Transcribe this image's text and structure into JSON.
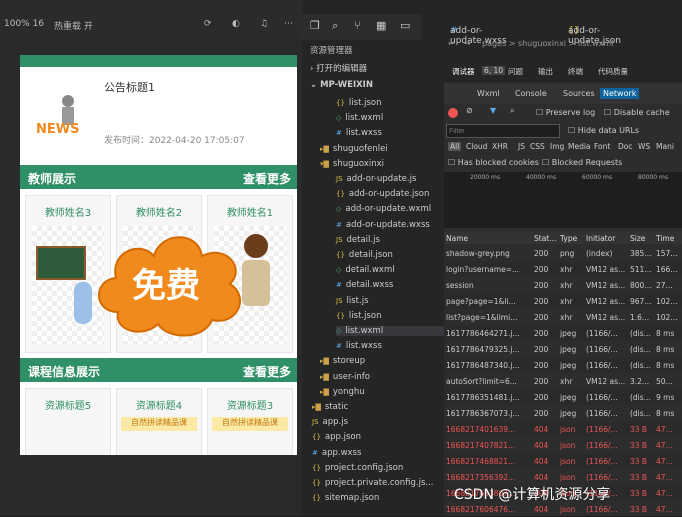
{
  "simulator": {
    "zoom": "100% 16",
    "mode": "热重载 开",
    "notice_title": "公告标题1",
    "notice_date": "发布时间：2022-04-20 17:05:07",
    "news_badge": "NEWS",
    "teacher_section": "教师展示",
    "more": "查看更多",
    "teachers": [
      "教师姓名3",
      "教师姓名2",
      "教师姓名1"
    ],
    "course_section": "课程信息展示",
    "resources": [
      "资源标题5",
      "资源标题4",
      "资源标题3"
    ],
    "banner_text": "自然拼读精品课",
    "free_badge": "免费"
  },
  "explorer": {
    "title": "资源管理器",
    "open_editors": "打开的编辑器",
    "project": "MP-WEIXIN",
    "items": [
      {
        "label": "list.json",
        "type": "json"
      },
      {
        "label": "list.wxml",
        "type": "wxml"
      },
      {
        "label": "list.wxss",
        "type": "wxss"
      },
      {
        "label": "shuguofenlei",
        "type": "folder"
      },
      {
        "label": "shuguoxinxi",
        "type": "folder-open"
      },
      {
        "label": "add-or-update.js",
        "type": "js"
      },
      {
        "label": "add-or-update.json",
        "type": "json"
      },
      {
        "label": "add-or-update.wxml",
        "type": "wxml"
      },
      {
        "label": "add-or-update.wxss",
        "type": "wxss"
      },
      {
        "label": "detail.js",
        "type": "js"
      },
      {
        "label": "detail.json",
        "type": "json"
      },
      {
        "label": "detail.wxml",
        "type": "wxml"
      },
      {
        "label": "detail.wxss",
        "type": "wxss"
      },
      {
        "label": "list.js",
        "type": "js"
      },
      {
        "label": "list.json",
        "type": "json"
      },
      {
        "label": "list.wxml",
        "type": "wxml"
      },
      {
        "label": "list.wxss",
        "type": "wxss"
      },
      {
        "label": "storeup",
        "type": "folder"
      },
      {
        "label": "user-info",
        "type": "folder"
      },
      {
        "label": "yonghu",
        "type": "folder"
      },
      {
        "label": "static",
        "type": "folder"
      },
      {
        "label": "app.js",
        "type": "js"
      },
      {
        "label": "app.json",
        "type": "json"
      },
      {
        "label": "app.wxss",
        "type": "wxss"
      },
      {
        "label": "project.config.json",
        "type": "json"
      },
      {
        "label": "project.private.config.js...",
        "type": "json"
      },
      {
        "label": "sitemap.json",
        "type": "json"
      }
    ]
  },
  "editor": {
    "tabs": [
      "add-or-update.wxss",
      "add-or-update.json"
    ],
    "breadcrumb": "pages > shuguoxinxi > list.wxml",
    "devtools_tabs": [
      "调试器",
      "6, 10",
      "问题",
      "输出",
      "终端",
      "代码质量"
    ],
    "panel_tabs": [
      "Wxml",
      "Console",
      "Sources",
      "Network"
    ],
    "preserve_log": "Preserve log",
    "disable_cache": "Disable cache",
    "filter_placeholder": "Filter",
    "hide_data_urls": "Hide data URLs",
    "filter_types": [
      "All",
      "Cloud",
      "XHR",
      "JS",
      "CSS",
      "Img",
      "Media",
      "Font",
      "Doc",
      "WS",
      "Mani"
    ],
    "has_blocked": "Has blocked cookies",
    "blocked_requests": "Blocked Requests",
    "timeline": [
      "20000 ms",
      "40000 ms",
      "60000 ms",
      "80000 ms"
    ],
    "columns": [
      "Name",
      "Stat...",
      "Type",
      "Initiator",
      "Size",
      "Time"
    ],
    "rows": [
      [
        "shadow-grey.png",
        "200",
        "png",
        "(index)",
        "385...",
        "157..."
      ],
      [
        "login?username=...",
        "200",
        "xhr",
        "VM12 as...",
        "511...",
        "166..."
      ],
      [
        "session",
        "200",
        "xhr",
        "VM12 as...",
        "800...",
        "27..."
      ],
      [
        "page?page=1&li...",
        "200",
        "xhr",
        "VM12 as...",
        "967...",
        "102..."
      ],
      [
        "list?page=1&limi...",
        "200",
        "xhr",
        "VM12 as...",
        "1.6...",
        "102..."
      ],
      [
        "1617786464271.j...",
        "200",
        "jpeg",
        "(1166/...",
        "(dis...",
        "8 ms"
      ],
      [
        "1617786479325.j...",
        "200",
        "jpeg",
        "(1166/...",
        "(dis...",
        "8 ms"
      ],
      [
        "1617786487340.j...",
        "200",
        "jpeg",
        "(1166/...",
        "(dis...",
        "8 ms"
      ],
      [
        "autoSort?limit=6...",
        "200",
        "xhr",
        "VM12 as...",
        "3.2...",
        "50..."
      ],
      [
        "1617786351481.j...",
        "200",
        "jpeg",
        "(1166/...",
        "(dis...",
        "9 ms"
      ],
      [
        "1617786367073.j...",
        "200",
        "jpeg",
        "(1166/...",
        "(dis...",
        "8 ms"
      ],
      [
        "1668217401639...",
        "404",
        "json",
        "(1166/...",
        "33 B",
        "47..."
      ],
      [
        "1668217407821...",
        "404",
        "json",
        "(1166/...",
        "33 B",
        "47..."
      ],
      [
        "1668217468821...",
        "404",
        "json",
        "(1166/...",
        "33 B",
        "47..."
      ],
      [
        "1668217356392...",
        "404",
        "json",
        "(1166/...",
        "33 B",
        "47..."
      ],
      [
        "1668217683807...",
        "404",
        "json",
        "(1166/...",
        "33 B",
        "47..."
      ],
      [
        "1668217606476...",
        "404",
        "json",
        "(1166/...",
        "33 B",
        "47..."
      ]
    ]
  },
  "watermark": "CSDN @计算机资源分享",
  "colors": {
    "accent": "#2f8f66",
    "network_active": "#0e639c",
    "error": "#e55555"
  }
}
